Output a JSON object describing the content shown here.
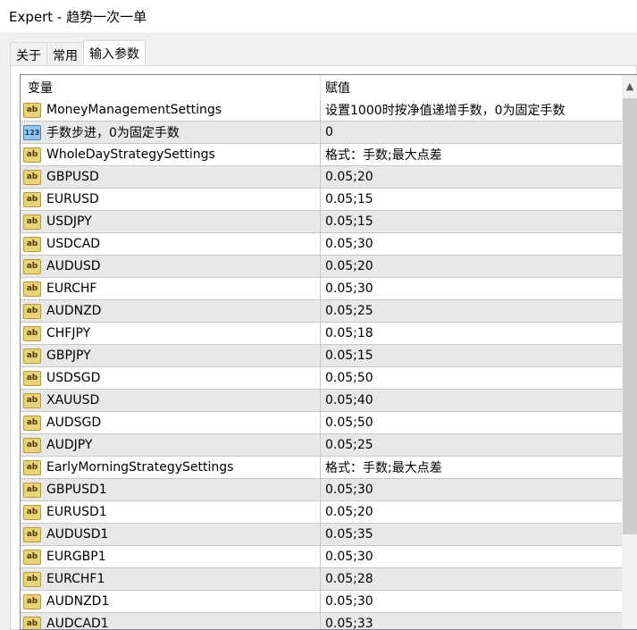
{
  "window": {
    "title": "Expert - 趋势一次一单"
  },
  "tabs": [
    {
      "label": "关于"
    },
    {
      "label": "常用"
    },
    {
      "label": "输入参数"
    }
  ],
  "table": {
    "headers": {
      "variable": "变量",
      "value": "赋值"
    },
    "rows": [
      {
        "icon": "ab",
        "name": "MoneyManagementSettings",
        "value": "设置1000时按净值递增手数，0为固定手数"
      },
      {
        "icon": "123",
        "name": "手数步进，0为固定手数",
        "value": "0"
      },
      {
        "icon": "ab",
        "name": "WholeDayStrategySettings",
        "value": "格式：手数;最大点差"
      },
      {
        "icon": "ab",
        "name": "GBPUSD",
        "value": "0.05;20"
      },
      {
        "icon": "ab",
        "name": "EURUSD",
        "value": "0.05;15"
      },
      {
        "icon": "ab",
        "name": "USDJPY",
        "value": "0.05;15"
      },
      {
        "icon": "ab",
        "name": "USDCAD",
        "value": "0.05;30"
      },
      {
        "icon": "ab",
        "name": "AUDUSD",
        "value": "0.05;20"
      },
      {
        "icon": "ab",
        "name": "EURCHF",
        "value": "0.05;30"
      },
      {
        "icon": "ab",
        "name": "AUDNZD",
        "value": "0.05;25"
      },
      {
        "icon": "ab",
        "name": "CHFJPY",
        "value": "0.05;18"
      },
      {
        "icon": "ab",
        "name": "GBPJPY",
        "value": "0.05;15"
      },
      {
        "icon": "ab",
        "name": "USDSGD",
        "value": "0.05;50"
      },
      {
        "icon": "ab",
        "name": "XAUUSD",
        "value": "0.05;40"
      },
      {
        "icon": "ab",
        "name": "AUDSGD",
        "value": "0.05;50"
      },
      {
        "icon": "ab",
        "name": "AUDJPY",
        "value": "0.05;25"
      },
      {
        "icon": "ab",
        "name": "EarlyMorningStrategySettings",
        "value": "格式：手数;最大点差"
      },
      {
        "icon": "ab",
        "name": "GBPUSD1",
        "value": "0.05;30"
      },
      {
        "icon": "ab",
        "name": "EURUSD1",
        "value": "0.05;20"
      },
      {
        "icon": "ab",
        "name": "AUDUSD1",
        "value": "0.05;35"
      },
      {
        "icon": "ab",
        "name": "EURGBP1",
        "value": "0.05;30"
      },
      {
        "icon": "ab",
        "name": "EURCHF1",
        "value": "0.05;28"
      },
      {
        "icon": "ab",
        "name": "AUDNZD1",
        "value": "0.05;30"
      },
      {
        "icon": "ab",
        "name": "AUDCAD1",
        "value": "0.05;33"
      }
    ]
  },
  "scrollbar": {
    "up_icon": "▲"
  }
}
